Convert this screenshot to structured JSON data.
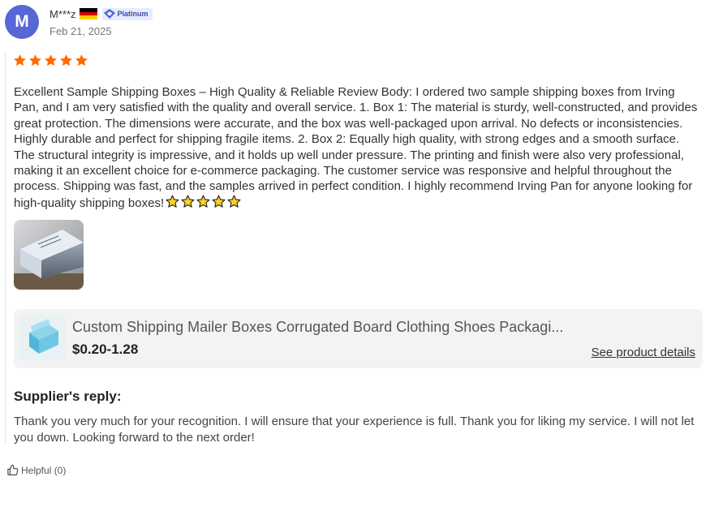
{
  "reviewer": {
    "avatar_letter": "M",
    "avatar_color": "#5667d6",
    "name": "M***z",
    "country_flag": "germany-flag-icon",
    "badge": "Platinum",
    "date": "Feb 21, 2025"
  },
  "rating": {
    "stars": 5,
    "max": 5,
    "color": "#ff6a00"
  },
  "review": {
    "text": "Excellent Sample Shipping Boxes – High Quality & Reliable Review Body: I ordered two sample shipping boxes from Irving Pan, and I am very satisfied with the quality and overall service. 1. Box 1: The material is sturdy, well-constructed, and provides great protection. The dimensions were accurate, and the box was well-packaged upon arrival. No defects or inconsistencies. Highly durable and perfect for shipping fragile items. 2. Box 2: Equally high quality, with strong edges and a smooth surface. The structural integrity is impressive, and it holds up well under pressure. The printing and finish were also very professional, making it an excellent choice for e-commerce packaging. The customer service was responsive and helpful throughout the process. Shipping was fast, and the samples arrived in perfect condition. I highly recommend Irving Pan for anyone looking for high-quality shipping boxes!",
    "trailing_emoji": "⭐⭐⭐⭐⭐"
  },
  "product": {
    "title": "Custom Shipping Mailer Boxes Corrugated Board Clothing Shoes Packagi...",
    "price": "$0.20-1.28",
    "link_label": "See product details"
  },
  "supplier_reply": {
    "heading": "Supplier's reply:",
    "text": "Thank you very much for your recognition. I will ensure that your experience is full. Thank you for liking my service. I will not let you down. Looking forward to the next order!"
  },
  "helpful": {
    "label": "Helpful (0)"
  }
}
